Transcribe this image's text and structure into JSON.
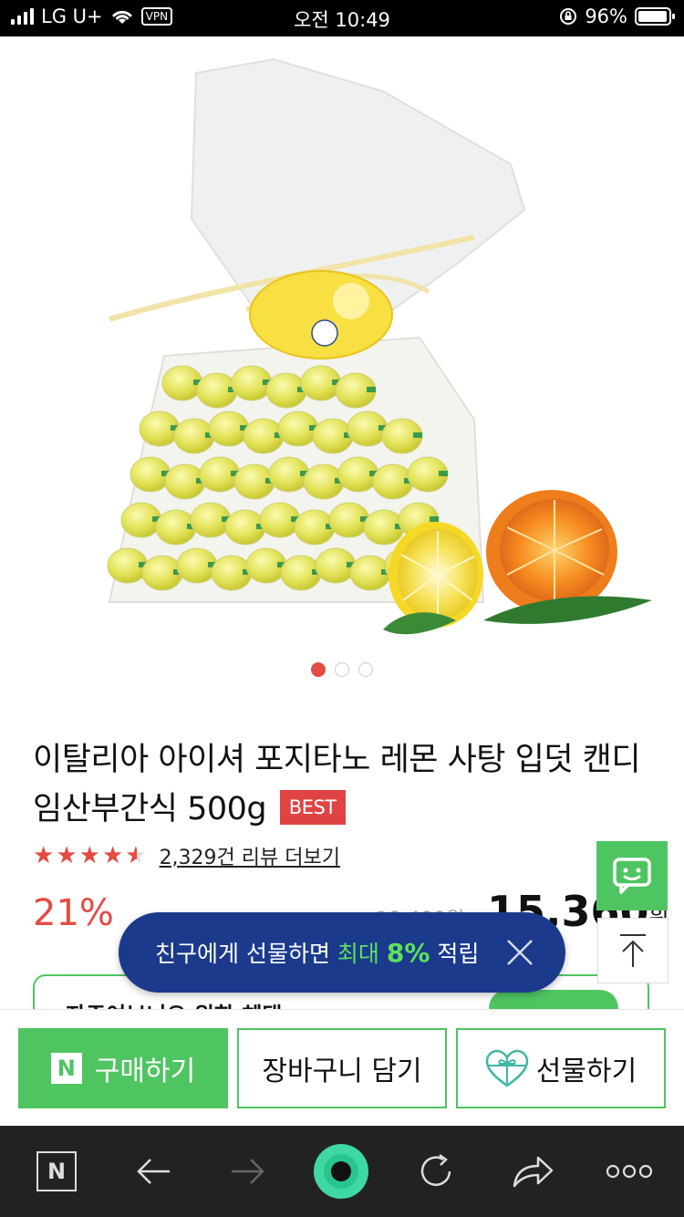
{
  "status_bar": {
    "carrier": "LG U+",
    "vpn": "VPN",
    "time": "오전 10:49",
    "battery": "96%",
    "battery_level": 0.96
  },
  "product": {
    "image_icon": "lemon-candy-bag-image",
    "carousel": {
      "count": 3,
      "active": 1
    },
    "title": "이탈리아 아이셔 포지타노 레몬 사탕 입덧 캔디 임산부간식 500g",
    "badge": "BEST",
    "rating": 4.5,
    "review_link": "2,329건 리뷰 더보기",
    "discount": "21%",
    "original_price": "19,400원",
    "price": "15,360",
    "price_unit": "원"
  },
  "partial_card": {
    "text": "자주여보니요 위한 혜택"
  },
  "toast": {
    "text_prefix": "친구에게 선물하면 ",
    "text_highlight": "최대 ",
    "text_highlight_bold": "8%",
    "text_suffix": " 적립",
    "close_icon": "close-icon"
  },
  "actions": {
    "buy_badge": "N",
    "buy_label": "구매하기",
    "cart_label": "장바구니 담기",
    "gift_label": "선물하기"
  },
  "browser": {
    "home_label": "N"
  },
  "colors": {
    "accent_green": "#4fc562",
    "sale_red": "#e44b43",
    "toast_navy": "#1b3a8c"
  }
}
